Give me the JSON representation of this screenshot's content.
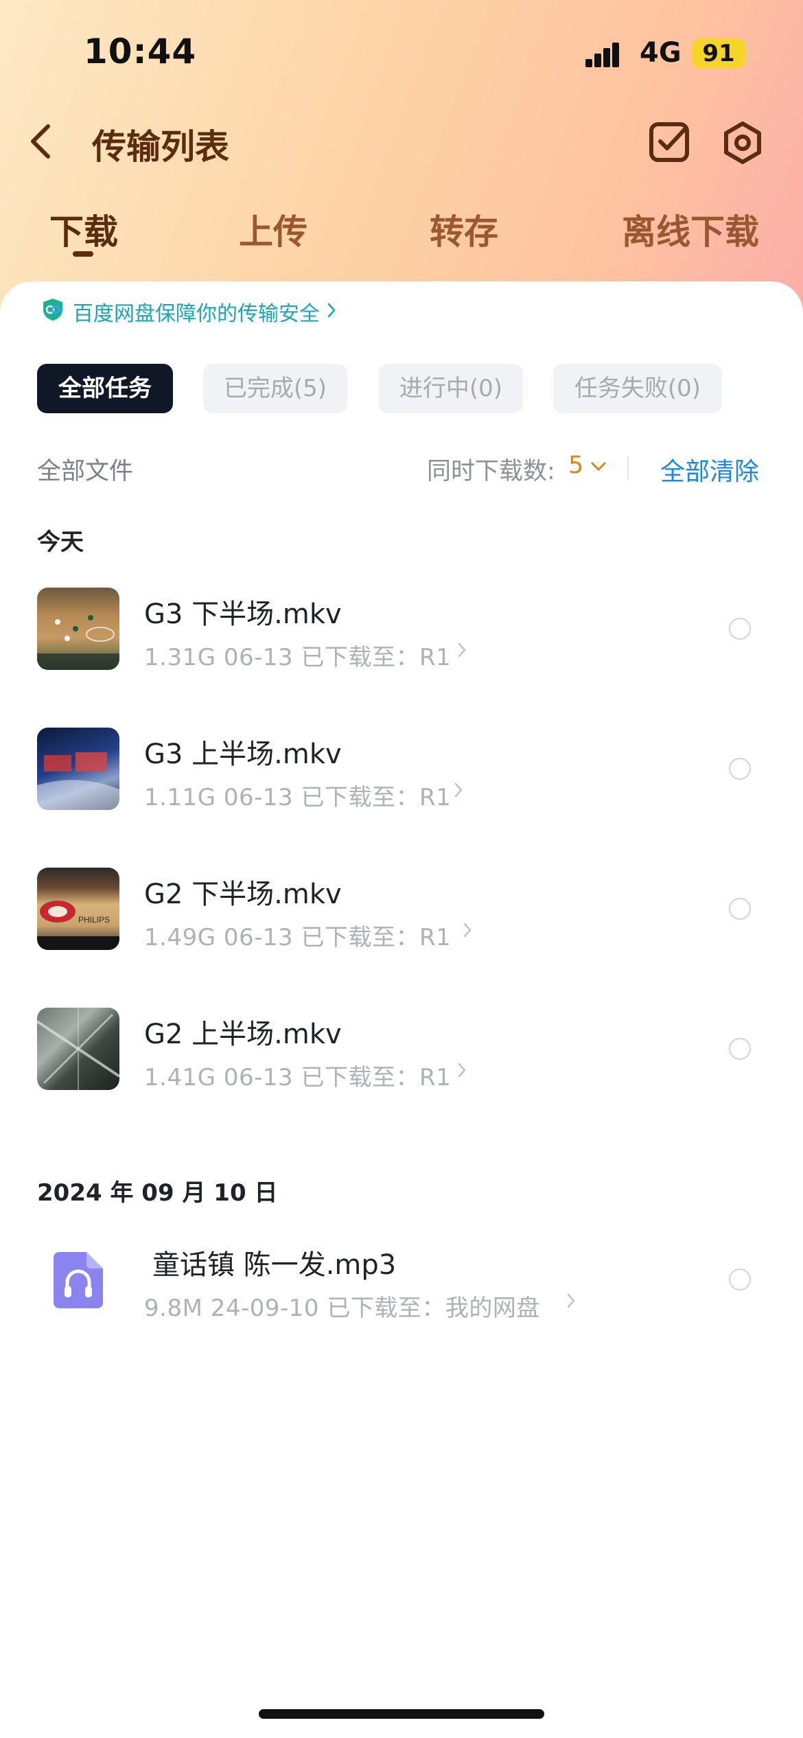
{
  "status_bar": {
    "time": "10:44",
    "network": "4G",
    "battery": "91"
  },
  "nav": {
    "title": "传输列表"
  },
  "tabs": [
    {
      "label": "下载",
      "active": true
    },
    {
      "label": "上传",
      "active": false
    },
    {
      "label": "转存",
      "active": false
    },
    {
      "label": "离线下载",
      "active": false
    }
  ],
  "banner": {
    "text": "百度网盘保障你的传输安全"
  },
  "filters": [
    {
      "label": "全部任务",
      "active": true
    },
    {
      "label": "已完成(5)",
      "active": false
    },
    {
      "label": "进行中(0)",
      "active": false
    },
    {
      "label": "任务失败(0)",
      "active": false
    }
  ],
  "toolbar": {
    "all_files": "全部文件",
    "concurrent_label": "同时下载数:",
    "concurrent_value": "5",
    "clear_all": "全部清除"
  },
  "sections": [
    {
      "title": "今天",
      "items": [
        {
          "name": "G3 下半场.mkv",
          "meta": "1.31G  06-13  已下载至：R1",
          "thumb": "court-green"
        },
        {
          "name": "G3 上半场.mkv",
          "meta": "1.11G  06-13  已下载至：R1",
          "thumb": "studio"
        },
        {
          "name": "G2 下半场.mkv",
          "meta": "1.49G  06-13  已下载至：R1",
          "thumb": "court-red"
        },
        {
          "name": "G2 上半场.mkv",
          "meta": "1.41G  06-13  已下载至：R1",
          "thumb": "arena-aerial"
        }
      ]
    },
    {
      "title": "2024 年 09 月 10 日",
      "items": [
        {
          "name": "童话镇 陈一发.mp3",
          "meta": "9.8M  24-09-10  已下载至：我的网盘",
          "thumb": "audio-file-icon"
        }
      ]
    }
  ],
  "colors": {
    "header_brown": "#5b2d10",
    "tab_inactive": "#9b5830",
    "accent_blue": "#1a88e8",
    "accent_orange": "#d9861f",
    "banner_teal": "#1aa6b4",
    "chip_active_bg": "#101828",
    "audio_icon": "#8b83f0"
  }
}
